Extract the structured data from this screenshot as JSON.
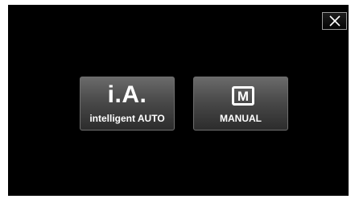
{
  "dialog": {
    "close_icon": "close-icon",
    "modes": [
      {
        "title": "i.A.",
        "label": "intelligent AUTO"
      },
      {
        "icon_letter": "M",
        "label": "MANUAL"
      }
    ]
  }
}
